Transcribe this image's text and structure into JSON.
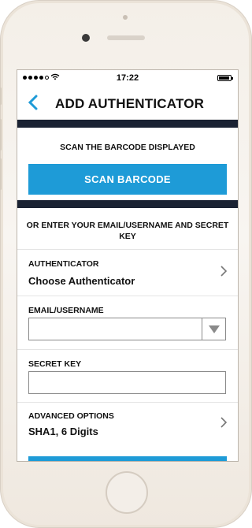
{
  "status_bar": {
    "time": "17:22",
    "battery_level": 0.9,
    "signal_bars_filled": 4,
    "signal_bars_total": 5,
    "wifi_icon": "wifi-icon"
  },
  "nav": {
    "back_icon": "chevron-left-icon",
    "title": "ADD AUTHENTICATOR"
  },
  "scan": {
    "label": "SCAN THE BARCODE DISPLAYED",
    "button_label": "SCAN BARCODE"
  },
  "manual_label": "OR ENTER YOUR EMAIL/USERNAME AND SECRET KEY",
  "authenticator": {
    "label": "AUTHENTICATOR",
    "value": "Choose Authenticator"
  },
  "email": {
    "label": "EMAIL/USERNAME",
    "value": ""
  },
  "secret": {
    "label": "SECRET KEY",
    "value": ""
  },
  "advanced": {
    "label": "ADVANCED OPTIONS",
    "value": "SHA1, 6 Digits"
  },
  "colors": {
    "accent": "#1e9bd7",
    "band": "#1a2233"
  }
}
